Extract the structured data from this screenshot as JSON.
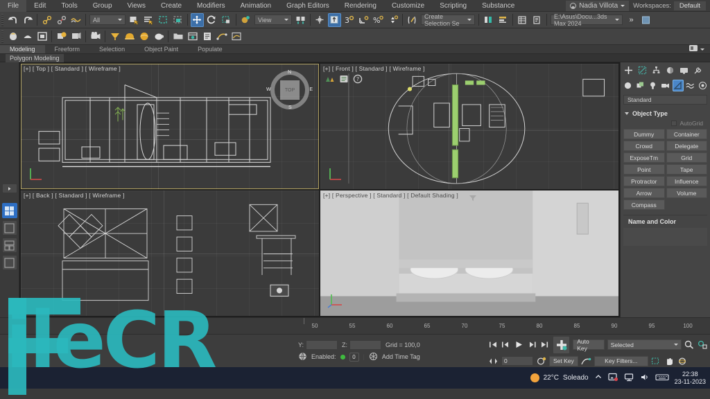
{
  "app": {
    "title": "3ds Max 2024"
  },
  "menubar": {
    "items": [
      "File",
      "Edit",
      "Tools",
      "Group",
      "Views",
      "Create",
      "Modifiers",
      "Animation",
      "Graph Editors",
      "Rendering",
      "Customize",
      "Scripting",
      "Substance"
    ],
    "user": "Nadia Villota",
    "workspaces_label": "Workspaces:",
    "workspace_value": "Default"
  },
  "toolbar": {
    "filter_value": "All",
    "ref_coord_value": "View",
    "selection_set_value": "Create Selection Se",
    "scene_path": "E:\\Asus\\Docu...3ds Max 2024",
    "overflow_label": "»",
    "icons_row1": [
      "undo-icon",
      "redo-icon",
      "link-icon",
      "unlink-icon",
      "bind-space-warp-icon",
      "select-object-icon",
      "select-by-name-icon",
      "rect-selection-region-icon",
      "window-crossing-icon",
      "select-and-move-icon",
      "select-and-rotate-icon",
      "select-and-scale-icon",
      "placement-icon",
      "reference-coordinate-icon",
      "pivot-center-icon",
      "snap-toggle-icon",
      "angle-snap-icon",
      "percent-snap-icon",
      "spinner-snap-icon",
      "edit-named-selection-icon",
      "mirror-icon",
      "align-icon",
      "layer-explorer-icon",
      "curve-editor-icon",
      "schematic-view-icon"
    ],
    "icons_row2": [
      "material-editor-icon",
      "render-setup-icon",
      "render-frame-icon",
      "render-production-icon",
      "render-iterative-icon",
      "active-shade-icon",
      "light-icon",
      "hard-hat-icon",
      "sphere-icon",
      "teapot-icon",
      "project-folder-icon",
      "asset-tracking-icon",
      "script-icon",
      "motion-paths-icon"
    ]
  },
  "ribbon": {
    "tabs": [
      "Modeling",
      "Freeform",
      "Selection",
      "Object Paint",
      "Populate"
    ],
    "selected_tab": "Modeling",
    "sub_label": "Polygon Modeling"
  },
  "viewports": [
    {
      "id": "top",
      "label": "[+] [ Top ] [ Standard ] [ Wireframe ]",
      "selected": true
    },
    {
      "id": "front",
      "label": "[+] [ Front ] [ Standard ] [ Wireframe ]",
      "selected": false
    },
    {
      "id": "back",
      "label": "[+] [ Back ] [ Standard ] [ Wireframe ]",
      "selected": false
    },
    {
      "id": "perspective",
      "label": "[+] [ Perspective ] [ Standard ] [ Default Shading ]",
      "selected": false
    }
  ],
  "viewcube": {
    "face_label": "TOP",
    "n": "N",
    "s": "S",
    "e": "E",
    "w": "W"
  },
  "command_panel": {
    "tabs": [
      "create-tab",
      "modify-tab",
      "hierarchy-tab",
      "motion-tab",
      "display-tab",
      "utilities-tab"
    ],
    "object_category_icons": [
      "geometry-icon",
      "shapes-icon",
      "lights-icon",
      "cameras-icon",
      "helpers-icon",
      "space-warps-icon",
      "systems-icon"
    ],
    "selected_category": "helpers-icon",
    "subcategory": "Standard",
    "rollout_object_type": "Object Type",
    "autogrid_label": "AutoGrid",
    "object_buttons": [
      "Dummy",
      "Container",
      "Crowd",
      "Delegate",
      "ExposeTm",
      "Grid",
      "Point",
      "Tape",
      "Protractor",
      "Influence",
      "Arrow",
      "Volume",
      "Compass"
    ],
    "rollout_name_color": "Name and Color"
  },
  "timeline": {
    "ticks": [
      50,
      55,
      60,
      65,
      70,
      75,
      80,
      85,
      90,
      95,
      100
    ]
  },
  "statusbar": {
    "coord_y_label": "Y:",
    "coord_z_label": "Z:",
    "coord_y_value": "",
    "coord_z_value": "",
    "grid_text": "Grid = 100,0",
    "enabled_label": "Enabled:",
    "enabled_count": "0",
    "add_time_tag": "Add Time Tag",
    "auto_key": "Auto Key",
    "set_key": "Set Key",
    "key_mode_value": "Selected",
    "key_filters": "Key Filters...",
    "frame_value": "0"
  },
  "taskbar": {
    "temperature": "22°C",
    "weather": "Soleado",
    "time": "22:38",
    "date": "23-11-2023",
    "tray_icons": [
      "chevron-up-icon",
      "onedrive-icon",
      "network-icon",
      "volume-icon",
      "keyboard-icon"
    ]
  },
  "watermark": {
    "text": "ileCR",
    "brand": "FileCR"
  }
}
